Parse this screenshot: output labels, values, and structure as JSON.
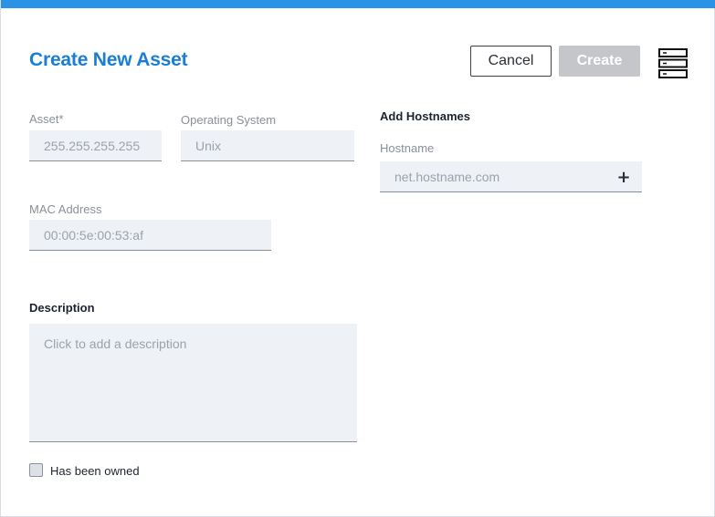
{
  "dialog": {
    "title": "Create New Asset",
    "cancel_label": "Cancel",
    "create_label": "Create"
  },
  "icons": {
    "server": "server-icon",
    "add": "plus-icon"
  },
  "form": {
    "asset": {
      "label": "Asset*",
      "placeholder": "255.255.255.255"
    },
    "os": {
      "label": "Operating System",
      "placeholder": "Unix"
    },
    "mac": {
      "label": "MAC Address",
      "placeholder": "00:00:5e:00:53:af"
    },
    "hostnames": {
      "heading": "Add Hostnames",
      "label": "Hostname",
      "placeholder": "net.hostname.com",
      "add_glyph": "+"
    },
    "description": {
      "label": "Description",
      "placeholder": "Click to add a description"
    },
    "owned": {
      "label": "Has been owned",
      "checked": false
    }
  },
  "colors": {
    "accent": "#2a93e6",
    "title": "#1a7fd4",
    "disabled_button": "#c4c6c9",
    "field_bg": "#eef1f6"
  }
}
